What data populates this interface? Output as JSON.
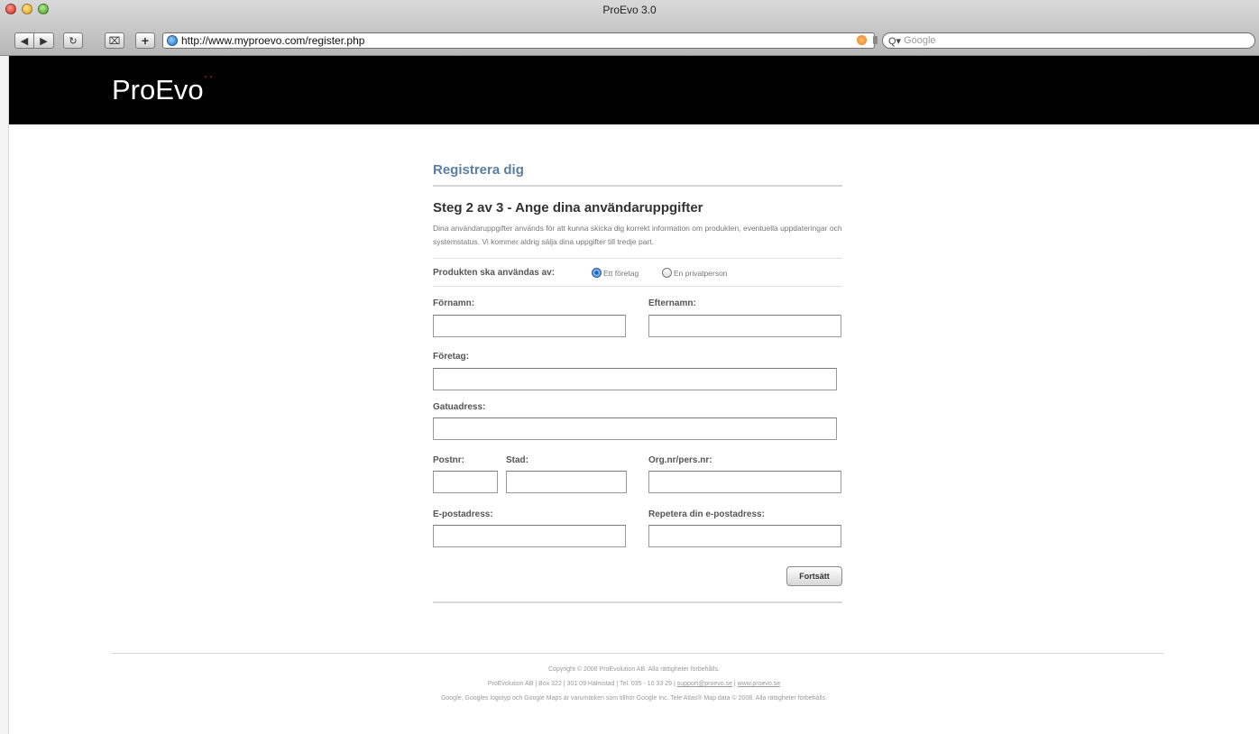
{
  "window": {
    "title": "ProEvo 3.0"
  },
  "toolbar": {
    "back_icon": "◀",
    "forward_icon": "▶",
    "reload_icon": "↻",
    "snapback_icon": "⌧",
    "add_bookmark_icon": "+",
    "url": "http://www.myproevo.com/register.php",
    "search_icon": "Q▾",
    "search_placeholder": "Google"
  },
  "header": {
    "logo_text": "ProEvo",
    "logo_mark": "˙˙"
  },
  "form": {
    "heading": "Registrera dig",
    "step_title": "Steg 2 av 3 - Ange dina användaruppgifter",
    "description": "Dina användaruppgifter används för att kunna skicka dig korrekt information om produkten, eventuella uppdateringar och systemstatus. Vi kommer aldrig sälja dina uppgifter till tredje part.",
    "usage_label": "Produkten ska användas av:",
    "usage_options": [
      {
        "label": "Ett företag",
        "checked": true
      },
      {
        "label": "En privatperson",
        "checked": false
      }
    ],
    "fields": {
      "first_name": {
        "label": "Förnamn:",
        "value": ""
      },
      "last_name": {
        "label": "Efternamn:",
        "value": ""
      },
      "company": {
        "label": "Företag:",
        "value": ""
      },
      "street": {
        "label": "Gatuadress:",
        "value": ""
      },
      "zip": {
        "label": "Postnr:",
        "value": ""
      },
      "city": {
        "label": "Stad:",
        "value": ""
      },
      "org_nr": {
        "label": "Org.nr/pers.nr:",
        "value": ""
      },
      "email": {
        "label": "E-postadress:",
        "value": ""
      },
      "email_repeat": {
        "label": "Repetera din e-postadress:",
        "value": ""
      }
    },
    "submit_label": "Fortsätt"
  },
  "footer": {
    "copyright": "Copyright © 2008 ProEvolution AB. Alla rättigheter förbehålls.",
    "address": "ProEvolution AB | Box 322 | 301 09 Halmstad | Tel. 035 - 10 33 29 | ",
    "email_link": "support@proevo.se",
    "separator": " | ",
    "site_link": "www.proevo.se",
    "trademark": "Google, Googles logotyp och Google Maps är varumärken som tillhör Google Inc. Tele Atlas® Map data © 2008. Alla rättigheter förbehålls."
  }
}
